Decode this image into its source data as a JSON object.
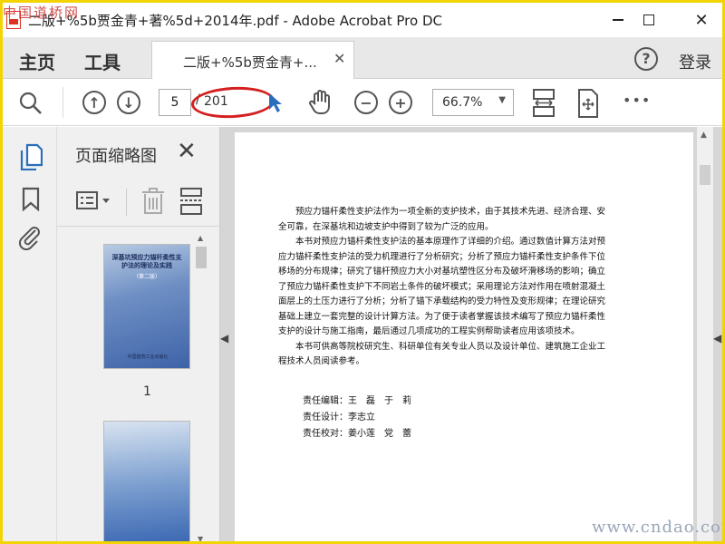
{
  "window": {
    "title": "二版+%5b贾金青+著%5d+2014年.pdf - Adobe Acrobat Pro DC",
    "watermark_top": "中国道桥网",
    "minimize": "–",
    "close": "✕"
  },
  "tabbar": {
    "home": "主页",
    "tools": "工具",
    "doc_tab": "二版+%5b贾金青+...",
    "doc_tab_close": "✕",
    "help": "?",
    "login": "登录"
  },
  "toolbar": {
    "current_page": "5",
    "slash": "/",
    "total_pages": "201",
    "zoom": "66.7%",
    "more": "•••"
  },
  "thumbnails": {
    "title": "页面缩略图",
    "close": "✕",
    "items": [
      {
        "cover_title": "深基坑预应力锚杆柔性支护法的理论及实践",
        "cover_sub": "（第二版）",
        "cover_pub": "中国建筑工业出版社",
        "label": "1"
      }
    ]
  },
  "document": {
    "paragraphs": [
      "预应力锚杆柔性支护法作为一项全新的支护技术，由于其技术先进、经济合理、安全可靠，在深基坑和边坡支护中得到了较为广泛的应用。",
      "本书对预应力锚杆柔性支护法的基本原理作了详细的介绍。通过数值计算方法对预应力锚杆柔性支护法的受力机理进行了分析研究；分析了预应力锚杆柔性支护条件下位移场的分布规律；研究了锚杆预应力大小对基坑塑性区分布及破坏滑移场的影响；确立了预应力锚杆柔性支护下不同岩土条件的破坏模式；采用理论方法对作用在喷射混凝土面层上的土压力进行了分析；分析了锚下承载结构的受力特性及变形规律；在理论研究基础上建立一套完整的设计计算方法。为了便于读者掌握该技术编写了预应力锚杆柔性支护的设计与施工指南，最后通过几项成功的工程实例帮助读者应用该项技术。",
      "本书可供高等院校研究生、科研单位有关专业人员以及设计单位、建筑施工企业工程技术人员阅读参考。"
    ],
    "credits": [
      "责任编辑：王　磊　于　莉",
      "责任设计：李志立",
      "责任校对：姜小莲　党　蕾"
    ]
  },
  "watermark_bottom": "www.cndao.com",
  "colors": {
    "accent_blue": "#2a6ebb",
    "annotation_red": "#d42020",
    "frame_yellow": "#f3d400"
  }
}
